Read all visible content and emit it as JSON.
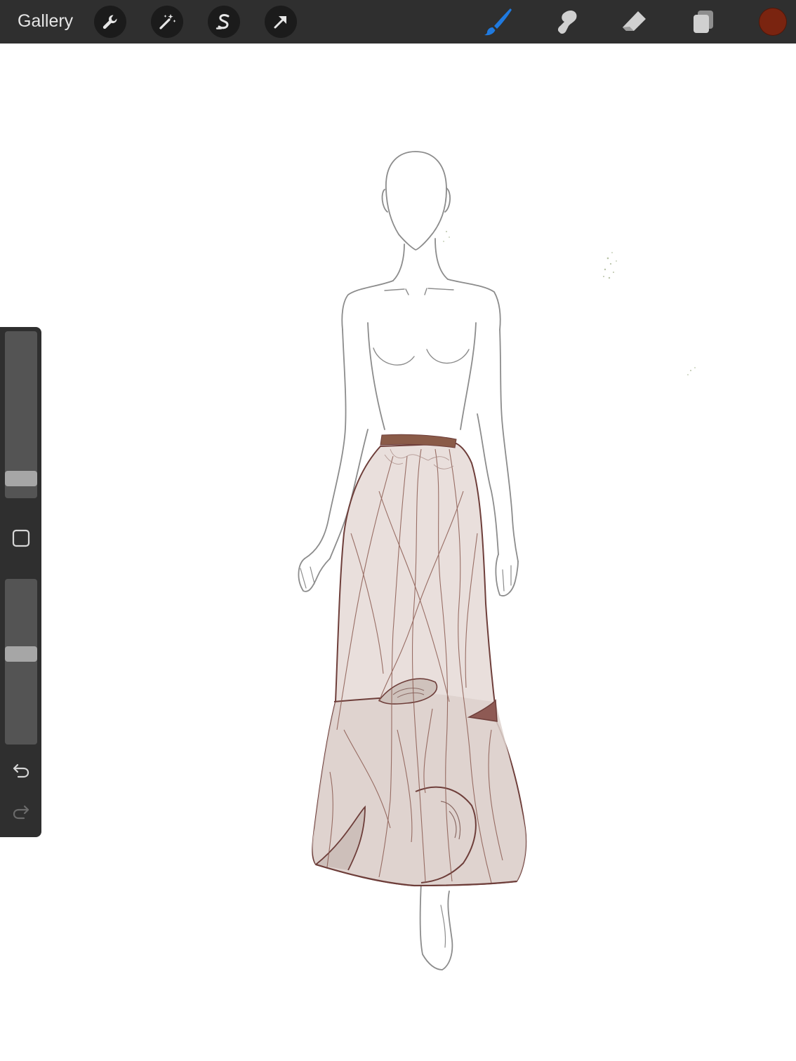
{
  "toolbar": {
    "gallery_label": "Gallery",
    "left_tools": [
      {
        "name": "actions",
        "icon": "wrench-icon"
      },
      {
        "name": "adjustments",
        "icon": "magic-wand-icon"
      },
      {
        "name": "selection",
        "icon": "selection-s-icon"
      },
      {
        "name": "transform",
        "icon": "arrow-cursor-icon"
      }
    ],
    "right_tools": [
      {
        "name": "brush",
        "icon": "brush-icon",
        "active": true
      },
      {
        "name": "smudge",
        "icon": "smudge-icon",
        "active": false
      },
      {
        "name": "eraser",
        "icon": "eraser-icon",
        "active": false
      },
      {
        "name": "layers",
        "icon": "layers-icon",
        "active": false
      }
    ],
    "current_color": "#7a2410",
    "active_tool_color": "#1f7ae0"
  },
  "sidebar": {
    "brush_size_level": 0.08,
    "opacity_level": 0.55,
    "modify_button_icon": "square-icon",
    "undo_icon": "undo-icon",
    "redo_icon": "redo-icon",
    "redo_enabled": false
  },
  "colors": {
    "toolbar_bg": "#2f2f2f",
    "sketch_line": "#8c8c8c",
    "skirt_fill": "#e9dfdc",
    "skirt_line": "#6e3e3a",
    "waistband": "#8a5b48"
  }
}
